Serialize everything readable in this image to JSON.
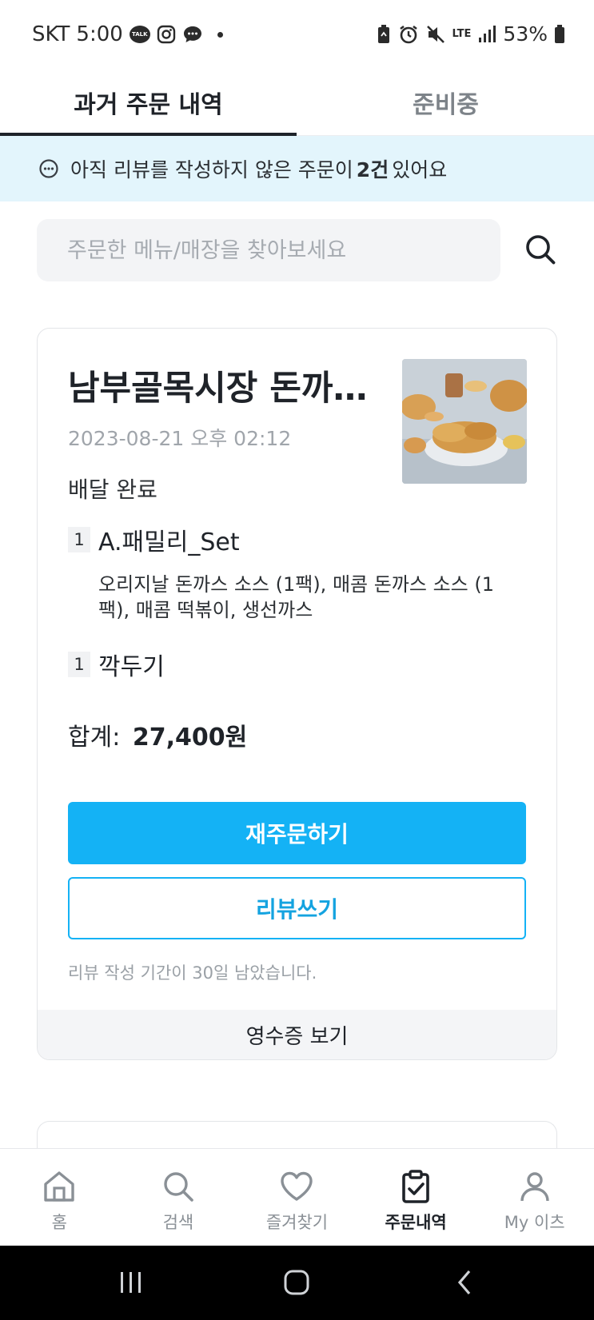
{
  "status_bar": {
    "carrier": "SKT",
    "time": "5:00",
    "talk_badge": "TALK",
    "network": "LTE",
    "battery": "53%",
    "icons": [
      "kakaotalk-icon",
      "instagram-icon",
      "message-icon",
      "battery-saver-icon",
      "alarm-icon",
      "mute-icon",
      "lte-icon",
      "signal-icon",
      "battery-icon"
    ]
  },
  "tabs": [
    {
      "label": "과거 주문 내역",
      "active": true
    },
    {
      "label": "준비중",
      "active": false
    }
  ],
  "banner": {
    "prefix": "아직 리뷰를 작성하지 않은 주문이",
    "count": "2건",
    "suffix": "있어요"
  },
  "search": {
    "placeholder": "주문한 메뉴/매장을 찾아보세요"
  },
  "order": {
    "store_name": "남부골목시장 돈까스 (남부골목시장)",
    "date": "2023-08-21 오후 02:12",
    "status": "배달 완료",
    "items": [
      {
        "qty": "1",
        "name": "A.패밀리_Set",
        "options": "오리지날 돈까스 소스 (1팩), 매콤 돈까스 소스 (1팩), 매콤 떡볶이, 생선까스"
      },
      {
        "qty": "1",
        "name": "깍두기"
      }
    ],
    "total_label": "합계:",
    "total_value": "27,400원",
    "reorder_label": "재주문하기",
    "review_label": "리뷰쓰기",
    "review_note": "리뷰 작성 기간이 30일 남았습니다.",
    "receipt_label": "영수증 보기"
  },
  "bottom_nav": [
    {
      "label": "홈",
      "icon": "home-icon",
      "active": false
    },
    {
      "label": "검색",
      "icon": "search-icon",
      "active": false
    },
    {
      "label": "즐겨찾기",
      "icon": "heart-icon",
      "active": false
    },
    {
      "label": "주문내역",
      "icon": "clipboard-check-icon",
      "active": true
    },
    {
      "label": "My 이츠",
      "icon": "person-icon",
      "active": false
    }
  ],
  "colors": {
    "accent": "#14b2f5",
    "banner_bg": "#e3f5fc",
    "text_primary": "#1f2329",
    "text_muted": "#a0a5ab"
  }
}
